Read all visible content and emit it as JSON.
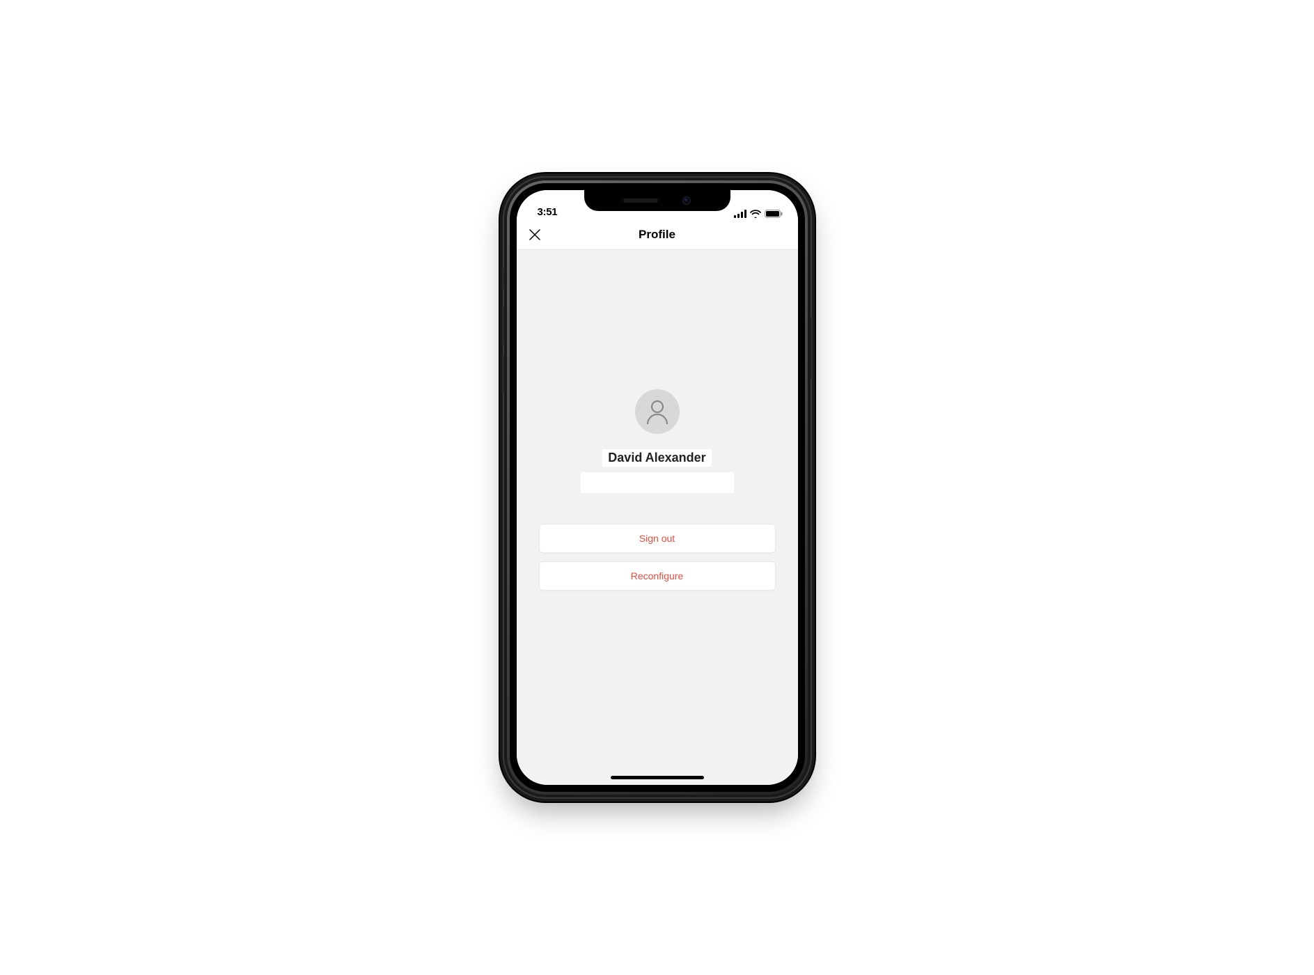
{
  "status_bar": {
    "time": "3:51"
  },
  "nav": {
    "title": "Profile"
  },
  "profile": {
    "name": "David Alexander",
    "email": ""
  },
  "actions": {
    "sign_out_label": "Sign out",
    "reconfigure_label": "Reconfigure"
  },
  "colors": {
    "accent_red": "#e94b3c",
    "content_bg": "#f2f2f2"
  }
}
